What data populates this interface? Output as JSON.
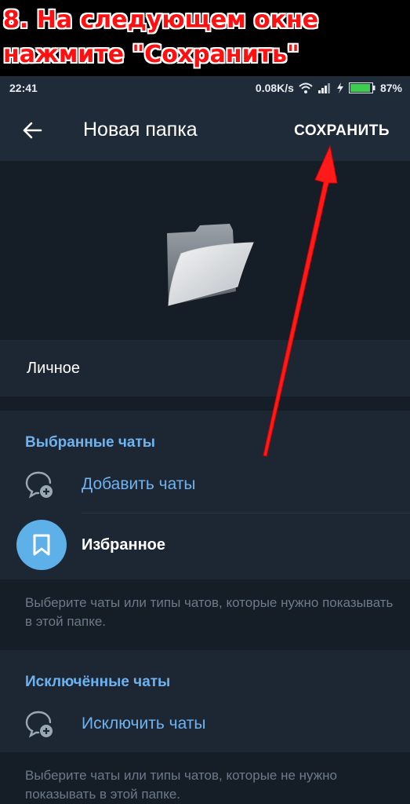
{
  "banner": {
    "line1": "8. На следующем окне",
    "line2": "нажмите \"Сохранить\""
  },
  "status": {
    "time": "22:41",
    "speed": "0.08K/s",
    "battery": "87%"
  },
  "toolbar": {
    "title": "Новая папка",
    "save_label": "СОХРАНИТЬ"
  },
  "folder_name": "Личное",
  "included": {
    "header": "Выбранные чаты",
    "add_label": "Добавить чаты",
    "chat_name": "Избранное",
    "hint": "Выберите чаты или типы чатов, которые нужно показывать в этой папке."
  },
  "excluded": {
    "header": "Исключённые чаты",
    "exclude_label": "Исключить чаты",
    "hint": "Выберите чаты или типы чатов, которые не нужно показывать в этой папке."
  },
  "colors": {
    "accent": "#6eb3f0",
    "arrow": "#ff1a1a",
    "avatar": "#5eb0e8"
  }
}
